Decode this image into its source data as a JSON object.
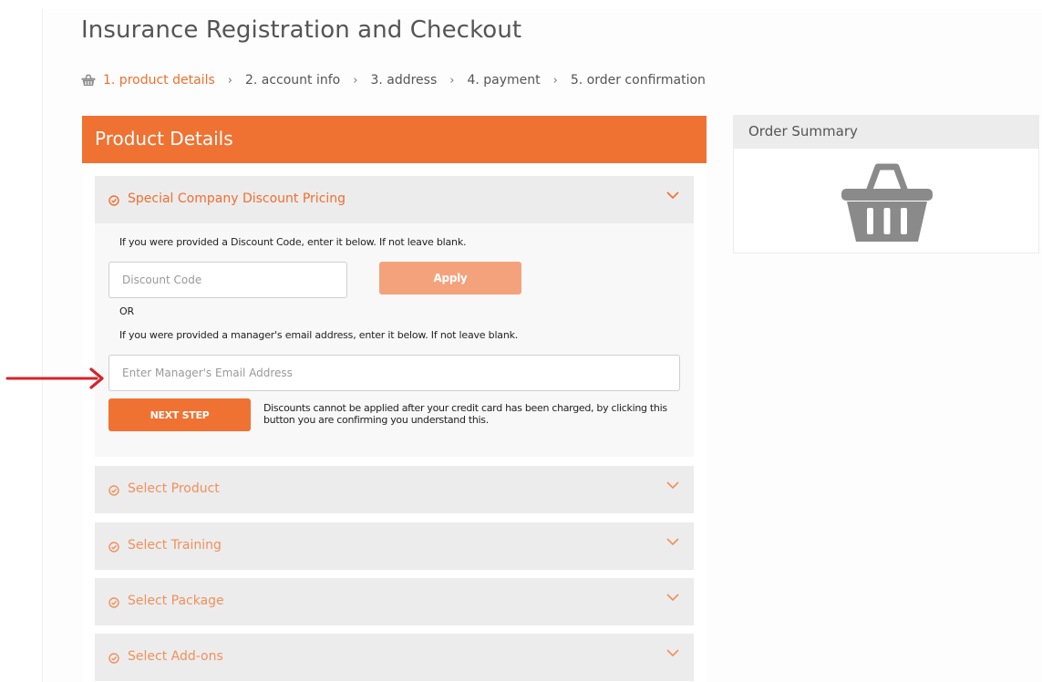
{
  "page": {
    "title": "Insurance Registration and Checkout"
  },
  "breadcrumb": {
    "icon": "basket-icon",
    "steps": [
      {
        "label": "1. product details",
        "active": true
      },
      {
        "label": "2. account info",
        "active": false
      },
      {
        "label": "3. address",
        "active": false
      },
      {
        "label": "4. payment",
        "active": false
      },
      {
        "label": "5. order confirmation",
        "active": false
      }
    ],
    "separator": "›"
  },
  "product_panel": {
    "header": "Product Details",
    "sections": [
      {
        "label": "Special Company Discount Pricing",
        "icon": "check-circle-icon",
        "expanded": true
      },
      {
        "label": "Select Product",
        "icon": "check-circle-icon",
        "expanded": false
      },
      {
        "label": "Select Training",
        "icon": "check-circle-icon",
        "expanded": false
      },
      {
        "label": "Select Package",
        "icon": "check-circle-icon",
        "expanded": false
      },
      {
        "label": "Select Add-ons",
        "icon": "check-circle-icon",
        "expanded": false
      }
    ],
    "discount": {
      "code_hint": "If you were provided a Discount Code, enter it below. If not leave blank.",
      "code_placeholder": "Discount Code",
      "code_value": "",
      "apply_label": "Apply",
      "or_label": "OR",
      "email_hint": "If you were provided a manager's email address, enter it below. If not leave blank.",
      "email_placeholder": "Enter Manager's Email Address",
      "email_value": "",
      "next_label": "NEXT STEP",
      "disclaimer": "Discounts cannot be applied after your credit card has been charged, by clicking this button you are confirming you understand this."
    }
  },
  "order_summary": {
    "header": "Order Summary",
    "icon": "basket-icon"
  },
  "annotation": {
    "icon": "red-arrow-icon"
  },
  "colors": {
    "accent": "#f07232",
    "accent_light": "#f4a27c",
    "section_bg": "#ececec",
    "annotation": "#d3242b",
    "icon_gray": "#8a8a8a"
  }
}
